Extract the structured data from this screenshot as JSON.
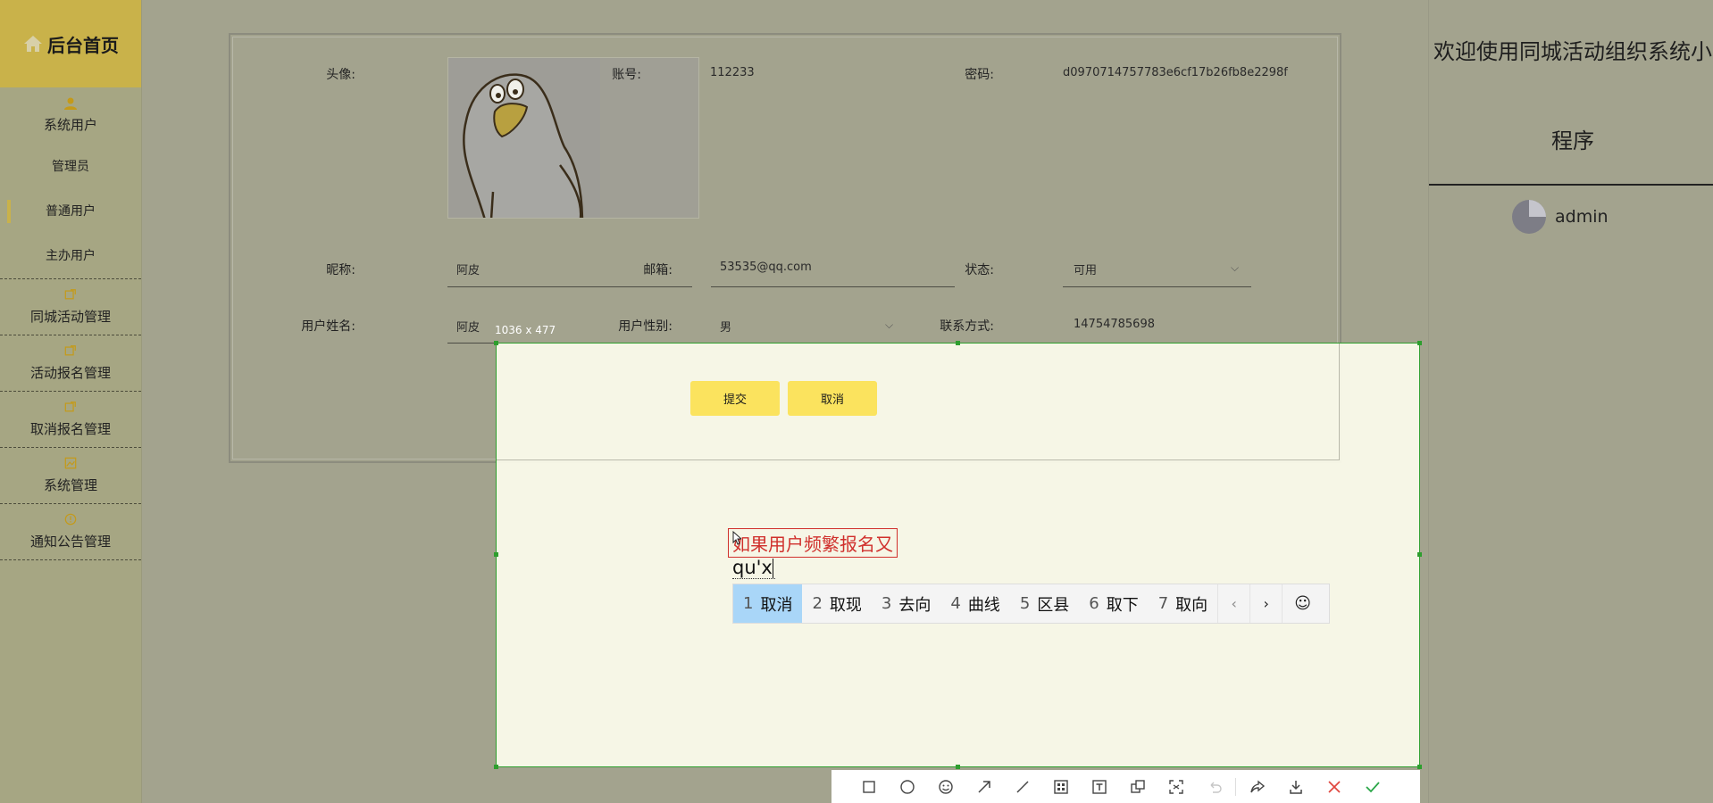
{
  "sidebar": {
    "brand": "后台首页",
    "groups": [
      {
        "label": "系统用户",
        "subs": [
          "管理员",
          "普通用户",
          "主办用户"
        ]
      },
      {
        "label": "同城活动管理"
      },
      {
        "label": "活动报名管理"
      },
      {
        "label": "取消报名管理"
      },
      {
        "label": "系统管理"
      },
      {
        "label": "通知公告管理"
      }
    ]
  },
  "form": {
    "avatar_label": "头像:",
    "account_label": "账号:",
    "account_value": "112233",
    "password_label": "密码:",
    "password_value": "d0970714757783e6cf17b26fb8e2298f",
    "nickname_label": "昵称:",
    "nickname_value": "阿皮",
    "email_label": "邮箱:",
    "email_value": "53535@qq.com",
    "status_label": "状态:",
    "status_value": "可用",
    "realname_label": "用户姓名:",
    "realname_value": "阿皮",
    "gender_label": "用户性别:",
    "gender_value": "男",
    "contact_label": "联系方式:",
    "contact_value": "14754785698",
    "submit_label": "提交",
    "cancel_label": "取消"
  },
  "header": {
    "welcome_line1": "欢迎使用同城活动组织系统小",
    "welcome_line2": "程序",
    "username": "admin"
  },
  "screenshot": {
    "dimensions": "1036 x 477",
    "annotation_text": "如果用户频繁报名又",
    "ime_input": "qu'x",
    "candidates": [
      {
        "num": "1",
        "text": "取消"
      },
      {
        "num": "2",
        "text": "取现"
      },
      {
        "num": "3",
        "text": "去向"
      },
      {
        "num": "4",
        "text": "曲线"
      },
      {
        "num": "5",
        "text": "区县"
      },
      {
        "num": "6",
        "text": "取下"
      },
      {
        "num": "7",
        "text": "取向"
      }
    ],
    "toolbar_icons": [
      "rectangle-icon",
      "ellipse-icon",
      "emoji-icon",
      "arrow-icon",
      "line-icon",
      "mosaic-icon",
      "text-icon",
      "pin-icon",
      "ocr-icon",
      "undo-icon",
      "share-icon",
      "save-icon",
      "close-icon",
      "confirm-icon"
    ]
  }
}
